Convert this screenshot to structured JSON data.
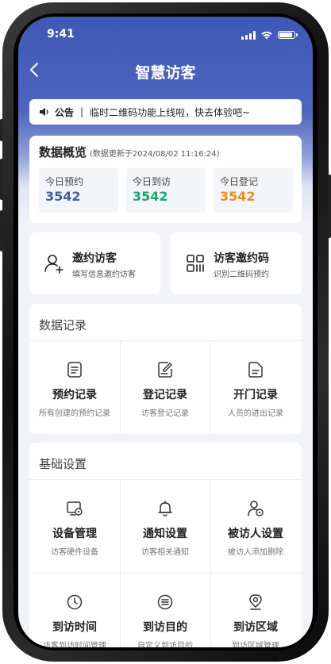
{
  "status_bar": {
    "time": "9:41"
  },
  "header": {
    "title": "智慧访客"
  },
  "notice": {
    "label": "公告",
    "separator": "|",
    "text": "临时二维码功能上线啦，快去体验吧~"
  },
  "overview": {
    "title": "数据概览",
    "updated": "(数据更新于2024/08/02 11:16:24)",
    "stats": [
      {
        "label": "今日预约",
        "value": "3542",
        "color": "#3f5fa8"
      },
      {
        "label": "今日到访",
        "value": "3542",
        "color": "#1aa56e"
      },
      {
        "label": "今日登记",
        "value": "3542",
        "color": "#f08a1c"
      }
    ]
  },
  "quick_actions": [
    {
      "title": "邀约访客",
      "subtitle": "填写信息邀约访客",
      "icon": "add-user-icon"
    },
    {
      "title": "访客邀约码",
      "subtitle": "识别二维码预约",
      "icon": "qr-code-icon"
    }
  ],
  "records": {
    "title": "数据记录",
    "items": [
      {
        "title": "预约记录",
        "subtitle": "所有创建的预约记录",
        "icon": "list-document-icon"
      },
      {
        "title": "登记记录",
        "subtitle": "访客登记记录",
        "icon": "edit-document-icon"
      },
      {
        "title": "开门记录",
        "subtitle": "人员的进出记录",
        "icon": "file-icon"
      }
    ]
  },
  "settings": {
    "title": "基础设置",
    "items": [
      {
        "title": "设备管理",
        "subtitle": "访客硬件设备",
        "icon": "device-settings-icon"
      },
      {
        "title": "通知设置",
        "subtitle": "访客相关通知",
        "icon": "bell-icon"
      },
      {
        "title": "被访人设置",
        "subtitle": "被访人添加删除",
        "icon": "user-settings-icon"
      },
      {
        "title": "到访时间",
        "subtitle": "访客到访时间管理",
        "icon": "clock-icon"
      },
      {
        "title": "到访目的",
        "subtitle": "自定义到访目的",
        "icon": "list-circle-icon"
      },
      {
        "title": "到访区域",
        "subtitle": "到访区域管理",
        "icon": "location-pin-icon"
      }
    ]
  }
}
